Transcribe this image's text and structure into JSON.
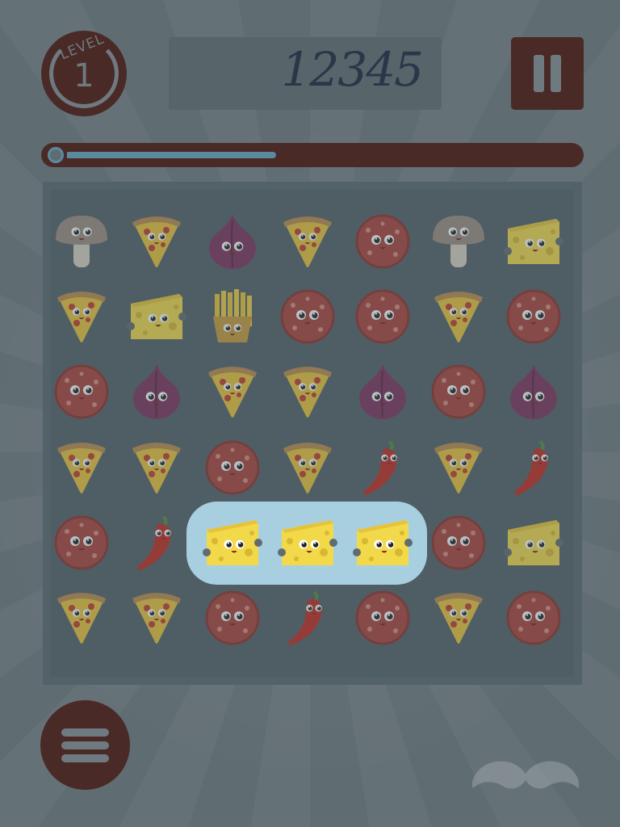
{
  "hud": {
    "level_label": "LEVEL",
    "level_number": "1",
    "score": "12345",
    "progress_fraction": 0.34
  },
  "icons": {
    "pause": "pause-icon",
    "menu": "hamburger-menu-icon",
    "logo": "mustache-icon"
  },
  "colors": {
    "dark_brown": "#4a2a26",
    "background": "#5f6c72",
    "board": "#536268",
    "match_highlight": "#a8cfe0",
    "progress_fill": "#5a8aa0"
  },
  "board": {
    "rows": 6,
    "cols": 7,
    "grid": [
      [
        "mushroom",
        "pizza",
        "onion",
        "pizza",
        "salami",
        "mushroom",
        "cheese"
      ],
      [
        "pizza",
        "cheese",
        "fries",
        "salami",
        "salami",
        "pizza",
        "salami"
      ],
      [
        "salami",
        "onion",
        "pizza",
        "pizza",
        "onion",
        "salami",
        "onion"
      ],
      [
        "pizza",
        "pizza",
        "salami",
        "pizza",
        "chili",
        "pizza",
        "chili"
      ],
      [
        "salami",
        "chili",
        "cheese",
        "cheese",
        "cheese",
        "salami",
        "cheese"
      ],
      [
        "pizza",
        "pizza",
        "salami",
        "chili",
        "salami",
        "pizza",
        "salami"
      ]
    ],
    "highlighted_match": {
      "row": 4,
      "cols": [
        2,
        3,
        4
      ],
      "item": "cheese"
    }
  }
}
